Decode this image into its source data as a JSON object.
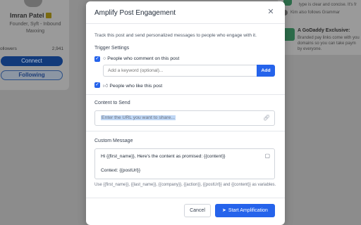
{
  "background": {
    "profile": {
      "name": "Imran Patel",
      "subtitle": "Founder, Syft - Inbound Maxxing",
      "followers_label": "ollowers",
      "followers_value": "2,941",
      "connect_label": "Connect",
      "following_label": "Following"
    },
    "right_panel": {
      "line1": "type is clear and concise. It's fr",
      "line2": "Kim also follows Grammar",
      "ad_title": "A GoDaddy Exclusive:",
      "ad_body": "Branded pay links come with you domains so you can take paym by everyone."
    }
  },
  "modal": {
    "title": "Amplify Post Engagement",
    "close_icon": "close-icon",
    "description": "Track this post and send personalized messages to people who engage with it.",
    "trigger_settings_label": "Trigger Settings",
    "comment_trigger": {
      "label": "People who comment on this post",
      "checked": true,
      "icon": "comment-icon"
    },
    "keyword_input": {
      "placeholder": "Add a keyword (optional)...",
      "value": ""
    },
    "add_button_label": "Add",
    "like_trigger": {
      "label": "People who like this post",
      "checked": true,
      "icon": "thumbs-up-icon"
    },
    "content_label": "Content to Send",
    "url_input": {
      "placeholder": "Enter the URL you want to share...",
      "value": ""
    },
    "custom_message_label": "Custom Message",
    "message_line1": "Hi {{first_name}}, Here's the content as promised: {{content}}",
    "message_line2": "Context: {{postUrl}}",
    "variables_help": "Use {{first_name}}, {{last_name}}, {{company}}, {{action}}, {{postUrl}} and {{content}} as variables.",
    "cancel_label": "Cancel",
    "start_label": "Start Amplification"
  },
  "colors": {
    "accent": "#2563eb",
    "overlay": "#8c8c8c"
  }
}
